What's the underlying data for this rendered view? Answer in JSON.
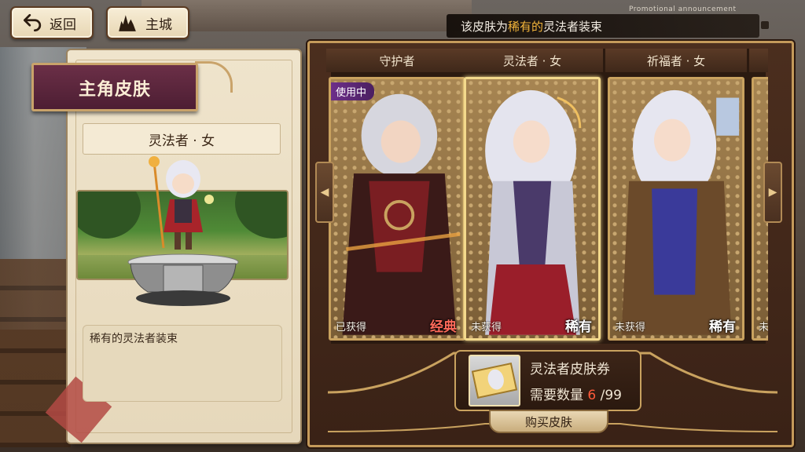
{
  "top": {
    "back_label": "返回",
    "city_label": "主城",
    "promo_text": "Promotional announcement",
    "announcement": {
      "prefix": "该皮肤为",
      "highlight": "稀有的",
      "suffix": "灵法者装束"
    }
  },
  "left_panel": {
    "title": "主角皮肤",
    "skin_name": "灵法者 · 女",
    "description": "稀有的灵法者装束"
  },
  "gallery": {
    "cards": [
      {
        "title": "守护者",
        "status": "已获得",
        "rarity": "经典",
        "rarity_color": "#ff6a5a",
        "badge": "使用中",
        "selected": false
      },
      {
        "title": "灵法者 · 女",
        "status": "未获得",
        "rarity": "稀有",
        "rarity_color": "#ffffff",
        "badge": "",
        "selected": true
      },
      {
        "title": "祈福者 · 女",
        "status": "未获得",
        "rarity": "稀有",
        "rarity_color": "#ffffff",
        "badge": "",
        "selected": false
      }
    ],
    "next_card_status": "未"
  },
  "shop": {
    "ticket_name": "灵法者皮肤券",
    "qty_label": "需要数量",
    "qty_need": "6",
    "qty_have": "/99",
    "buy_label": "购买皮肤"
  },
  "colors": {
    "highlight": "#f2b43a",
    "need_qty": "#ff5a3a",
    "frame_gold": "#c9a25f"
  },
  "icons": {
    "back": "back-arrow-icon",
    "city": "castle-icon",
    "left_arrow": "chevron-left-icon",
    "right_arrow": "chevron-right-icon"
  }
}
